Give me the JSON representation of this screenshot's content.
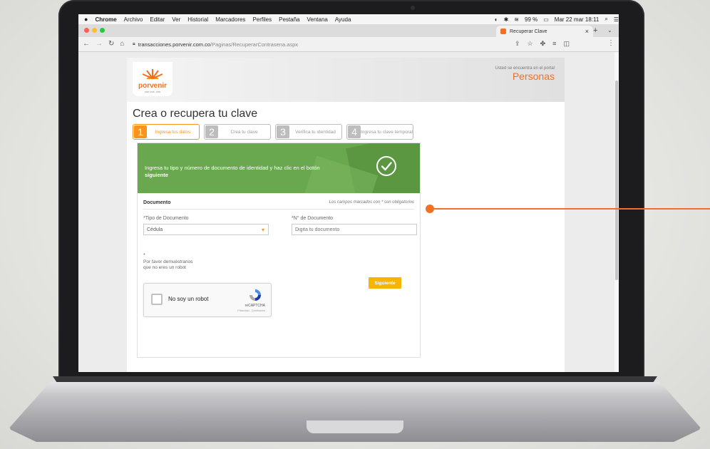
{
  "menubar": {
    "apple": "",
    "app": "Chrome",
    "items": [
      "Archivo",
      "Editar",
      "Ver",
      "Historial",
      "Marcadores",
      "Perfiles",
      "Pestaña",
      "Ventana",
      "Ayuda"
    ],
    "battery": "99 %",
    "datetime": "Mar 22 mar 18:11"
  },
  "browser": {
    "tab_title": "Recuperar Clave",
    "url_host": "transacciones.porvenir.com.co",
    "url_path": "/Paginas/RecuperarContrasena.aspx"
  },
  "site": {
    "logo_text": "porvenir",
    "logo_sub": "con vos, vos",
    "portal_note": "Usted se encuentra en el portal",
    "portal_name": "Personas"
  },
  "page": {
    "title": "Crea o recupera tu clave",
    "steps": [
      {
        "num": "1",
        "label": "Ingresa tus datos"
      },
      {
        "num": "2",
        "label": "Crea tu clave"
      },
      {
        "num": "3",
        "label": "Verifica tu identidad"
      },
      {
        "num": "4",
        "label": "Ingresa tu clave temporal"
      }
    ],
    "active_step": 1
  },
  "banner": {
    "text": "Ingresa tu tipo y número de documento de identidad y haz clic en el botón",
    "bold": "siguiente"
  },
  "form": {
    "section": "Documento",
    "required_note": "Los campos marcados con * son obligatorios",
    "doc_type_label": "*Tipo de Documento",
    "doc_type_value": "Cédula",
    "doc_number_label": "*N° de Documento",
    "doc_number_placeholder": "Digita tu documento",
    "asterisk": "*",
    "captcha_note": "Por favor demuéstranos que no eres un robot",
    "recaptcha_label": "No soy un robot",
    "recaptcha_brand": "reCAPTCHA",
    "recaptcha_terms": "Privacidad - Condiciones",
    "next_button": "Siguiente"
  },
  "colors": {
    "brand_orange": "#f36f21",
    "step_orange": "#f7941d",
    "banner_green": "#6aa84f",
    "button_yellow": "#f7b500"
  }
}
